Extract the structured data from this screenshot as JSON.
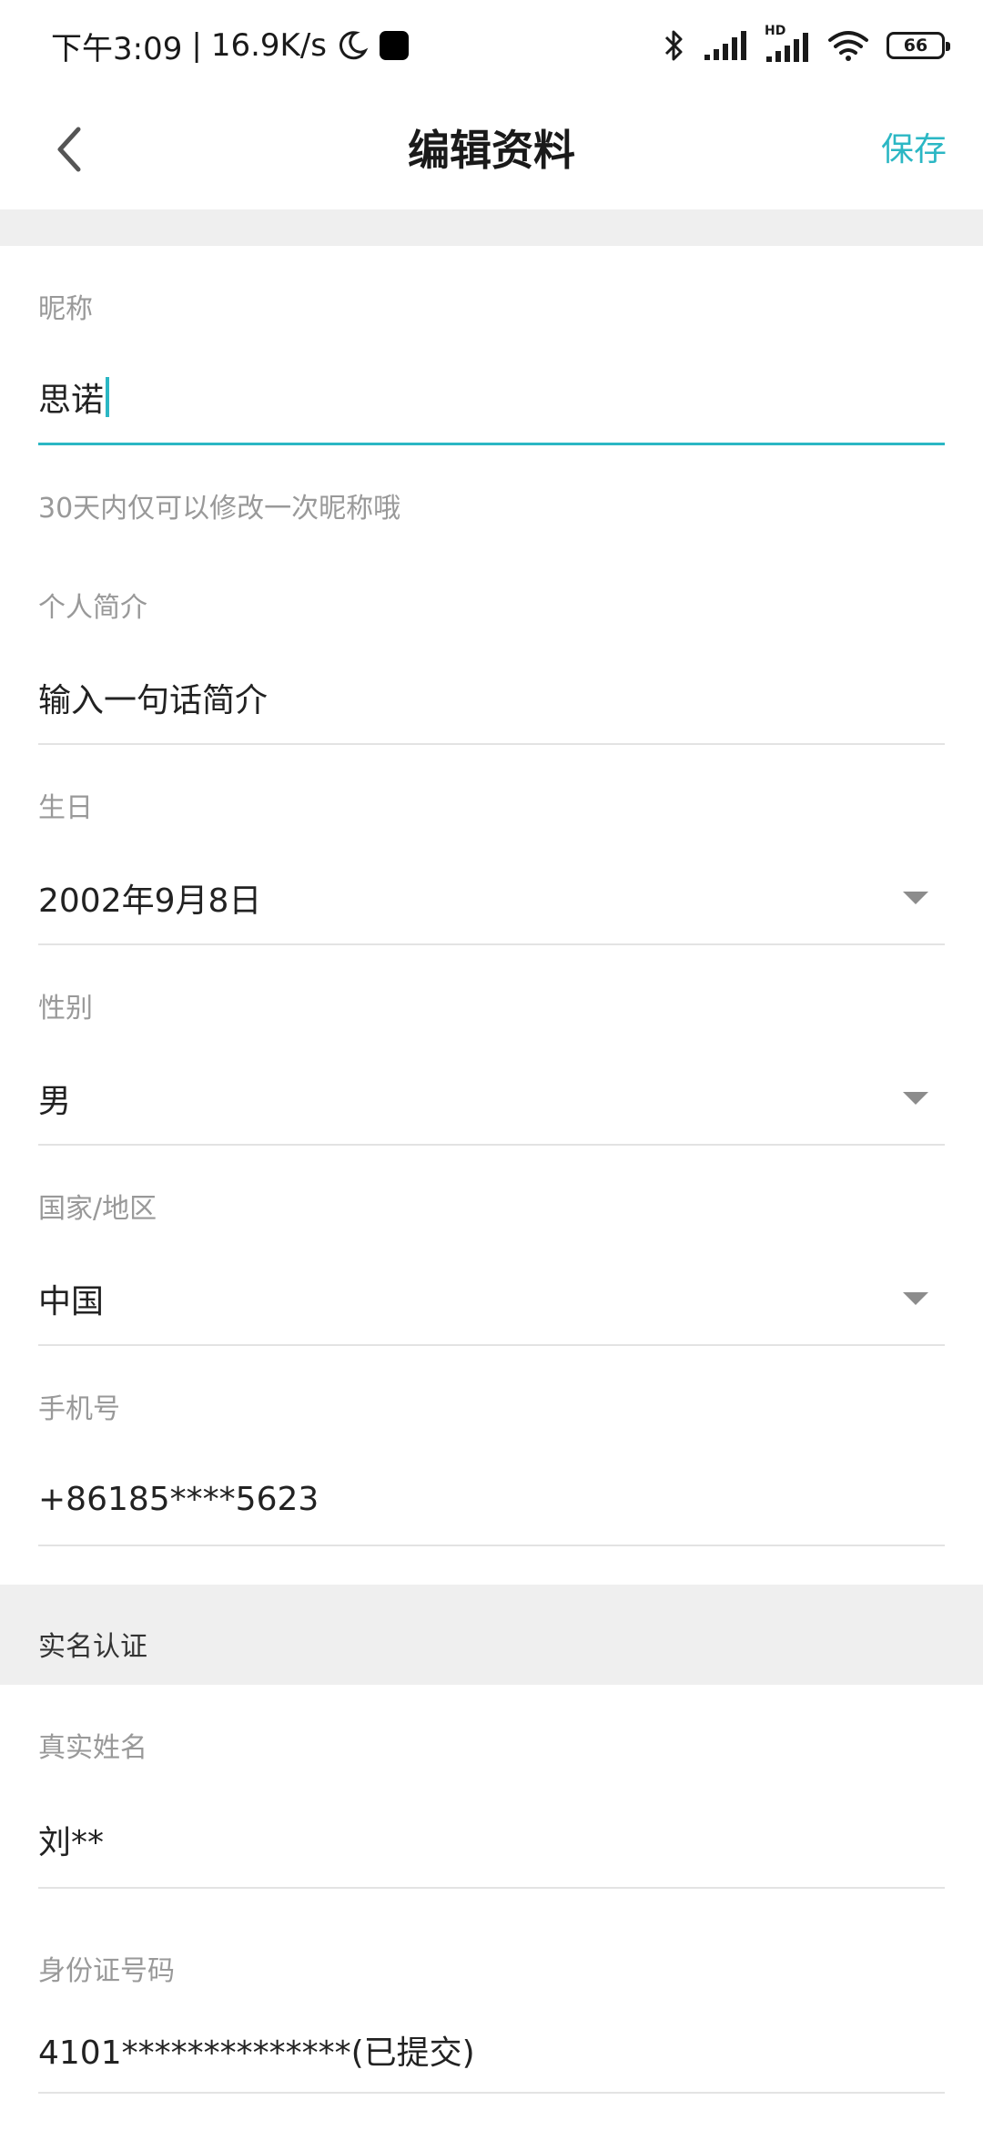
{
  "status_bar": {
    "time": "下午3:09",
    "separator": "|",
    "speed": "16.9K/s",
    "battery": "66",
    "hd_label": "HD"
  },
  "header": {
    "title": "编辑资料",
    "save_label": "保存"
  },
  "fields": {
    "nickname": {
      "label": "昵称",
      "value": "思诺"
    },
    "nickname_hint": "30天内仅可以修改一次昵称哦",
    "bio": {
      "label": "个人简介",
      "value": "输入一句话简介"
    },
    "birthday": {
      "label": "生日",
      "value": "2002年9月8日"
    },
    "gender": {
      "label": "性别",
      "value": "男"
    },
    "region": {
      "label": "国家/地区",
      "value": "中国"
    },
    "phone": {
      "label": "手机号",
      "value": "+86185****5623"
    }
  },
  "verification": {
    "section_title": "实名认证",
    "real_name": {
      "label": "真实姓名",
      "value": "刘**"
    },
    "id_number": {
      "label": "身份证号码",
      "value": "4101**************(已提交)"
    }
  },
  "colors": {
    "accent": "#2bb7c4",
    "label": "#999999",
    "band": "#efefef"
  }
}
